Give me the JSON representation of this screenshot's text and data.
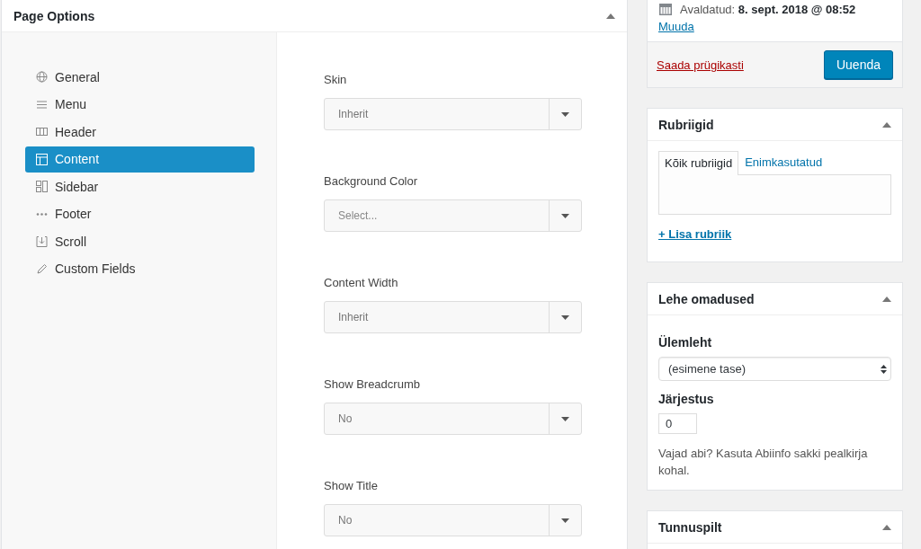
{
  "page_options": {
    "title": "Page Options",
    "nav": [
      {
        "label": "General",
        "selected": false
      },
      {
        "label": "Menu",
        "selected": false
      },
      {
        "label": "Header",
        "selected": false
      },
      {
        "label": "Content",
        "selected": true
      },
      {
        "label": "Sidebar",
        "selected": false
      },
      {
        "label": "Footer",
        "selected": false
      },
      {
        "label": "Scroll",
        "selected": false
      },
      {
        "label": "Custom Fields",
        "selected": false
      }
    ],
    "fields": [
      {
        "label": "Skin",
        "value": "Inherit"
      },
      {
        "label": "Background Color",
        "placeholder": "Select..."
      },
      {
        "label": "Content Width",
        "value": "Inherit"
      },
      {
        "label": "Show Breadcrumb",
        "value": "No"
      },
      {
        "label": "Show Title",
        "value": "No"
      }
    ]
  },
  "publish": {
    "published": "Avaldatud: **8. sept. 2018 @ 08:52**",
    "edit_link": "Muuda",
    "trash_link": "Saada prügikasti",
    "update_button": "Uuenda"
  },
  "categories": {
    "title": "Rubriigid",
    "tabs": [
      {
        "label": "Kõik rubriigid",
        "selected": true
      },
      {
        "label": "Enimkasutatud",
        "selected": false
      }
    ],
    "add_link": "+ Lisa rubriik"
  },
  "page_attributes": {
    "title": "Lehe omadused",
    "parent_label": "Ülemleht",
    "parent_value": "(esimene tase)",
    "order_label": "Järjestus",
    "order_value": "0",
    "help": "Vajad abi? Kasuta Abiinfo sakki pealkirja kohal."
  },
  "featured_image": {
    "title": "Tunnuspilt"
  }
}
